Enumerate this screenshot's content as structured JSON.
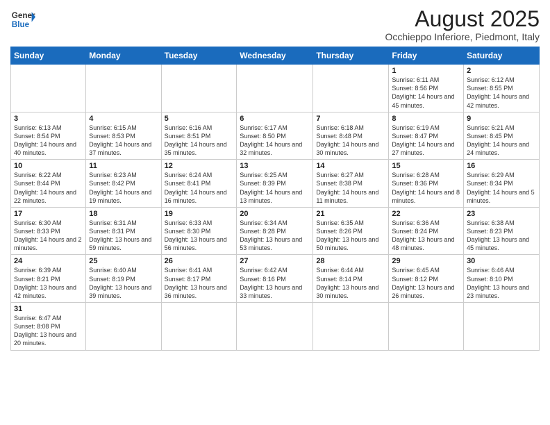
{
  "header": {
    "logo_general": "General",
    "logo_blue": "Blue",
    "title": "August 2025",
    "subtitle": "Occhieppo Inferiore, Piedmont, Italy"
  },
  "weekdays": [
    "Sunday",
    "Monday",
    "Tuesday",
    "Wednesday",
    "Thursday",
    "Friday",
    "Saturday"
  ],
  "weeks": [
    [
      {
        "day": "",
        "info": ""
      },
      {
        "day": "",
        "info": ""
      },
      {
        "day": "",
        "info": ""
      },
      {
        "day": "",
        "info": ""
      },
      {
        "day": "",
        "info": ""
      },
      {
        "day": "1",
        "info": "Sunrise: 6:11 AM\nSunset: 8:56 PM\nDaylight: 14 hours and 45 minutes."
      },
      {
        "day": "2",
        "info": "Sunrise: 6:12 AM\nSunset: 8:55 PM\nDaylight: 14 hours and 42 minutes."
      }
    ],
    [
      {
        "day": "3",
        "info": "Sunrise: 6:13 AM\nSunset: 8:54 PM\nDaylight: 14 hours and 40 minutes."
      },
      {
        "day": "4",
        "info": "Sunrise: 6:15 AM\nSunset: 8:53 PM\nDaylight: 14 hours and 37 minutes."
      },
      {
        "day": "5",
        "info": "Sunrise: 6:16 AM\nSunset: 8:51 PM\nDaylight: 14 hours and 35 minutes."
      },
      {
        "day": "6",
        "info": "Sunrise: 6:17 AM\nSunset: 8:50 PM\nDaylight: 14 hours and 32 minutes."
      },
      {
        "day": "7",
        "info": "Sunrise: 6:18 AM\nSunset: 8:48 PM\nDaylight: 14 hours and 30 minutes."
      },
      {
        "day": "8",
        "info": "Sunrise: 6:19 AM\nSunset: 8:47 PM\nDaylight: 14 hours and 27 minutes."
      },
      {
        "day": "9",
        "info": "Sunrise: 6:21 AM\nSunset: 8:45 PM\nDaylight: 14 hours and 24 minutes."
      }
    ],
    [
      {
        "day": "10",
        "info": "Sunrise: 6:22 AM\nSunset: 8:44 PM\nDaylight: 14 hours and 22 minutes."
      },
      {
        "day": "11",
        "info": "Sunrise: 6:23 AM\nSunset: 8:42 PM\nDaylight: 14 hours and 19 minutes."
      },
      {
        "day": "12",
        "info": "Sunrise: 6:24 AM\nSunset: 8:41 PM\nDaylight: 14 hours and 16 minutes."
      },
      {
        "day": "13",
        "info": "Sunrise: 6:25 AM\nSunset: 8:39 PM\nDaylight: 14 hours and 13 minutes."
      },
      {
        "day": "14",
        "info": "Sunrise: 6:27 AM\nSunset: 8:38 PM\nDaylight: 14 hours and 11 minutes."
      },
      {
        "day": "15",
        "info": "Sunrise: 6:28 AM\nSunset: 8:36 PM\nDaylight: 14 hours and 8 minutes."
      },
      {
        "day": "16",
        "info": "Sunrise: 6:29 AM\nSunset: 8:34 PM\nDaylight: 14 hours and 5 minutes."
      }
    ],
    [
      {
        "day": "17",
        "info": "Sunrise: 6:30 AM\nSunset: 8:33 PM\nDaylight: 14 hours and 2 minutes."
      },
      {
        "day": "18",
        "info": "Sunrise: 6:31 AM\nSunset: 8:31 PM\nDaylight: 13 hours and 59 minutes."
      },
      {
        "day": "19",
        "info": "Sunrise: 6:33 AM\nSunset: 8:30 PM\nDaylight: 13 hours and 56 minutes."
      },
      {
        "day": "20",
        "info": "Sunrise: 6:34 AM\nSunset: 8:28 PM\nDaylight: 13 hours and 53 minutes."
      },
      {
        "day": "21",
        "info": "Sunrise: 6:35 AM\nSunset: 8:26 PM\nDaylight: 13 hours and 50 minutes."
      },
      {
        "day": "22",
        "info": "Sunrise: 6:36 AM\nSunset: 8:24 PM\nDaylight: 13 hours and 48 minutes."
      },
      {
        "day": "23",
        "info": "Sunrise: 6:38 AM\nSunset: 8:23 PM\nDaylight: 13 hours and 45 minutes."
      }
    ],
    [
      {
        "day": "24",
        "info": "Sunrise: 6:39 AM\nSunset: 8:21 PM\nDaylight: 13 hours and 42 minutes."
      },
      {
        "day": "25",
        "info": "Sunrise: 6:40 AM\nSunset: 8:19 PM\nDaylight: 13 hours and 39 minutes."
      },
      {
        "day": "26",
        "info": "Sunrise: 6:41 AM\nSunset: 8:17 PM\nDaylight: 13 hours and 36 minutes."
      },
      {
        "day": "27",
        "info": "Sunrise: 6:42 AM\nSunset: 8:16 PM\nDaylight: 13 hours and 33 minutes."
      },
      {
        "day": "28",
        "info": "Sunrise: 6:44 AM\nSunset: 8:14 PM\nDaylight: 13 hours and 30 minutes."
      },
      {
        "day": "29",
        "info": "Sunrise: 6:45 AM\nSunset: 8:12 PM\nDaylight: 13 hours and 26 minutes."
      },
      {
        "day": "30",
        "info": "Sunrise: 6:46 AM\nSunset: 8:10 PM\nDaylight: 13 hours and 23 minutes."
      }
    ],
    [
      {
        "day": "31",
        "info": "Sunrise: 6:47 AM\nSunset: 8:08 PM\nDaylight: 13 hours and 20 minutes."
      },
      {
        "day": "",
        "info": ""
      },
      {
        "day": "",
        "info": ""
      },
      {
        "day": "",
        "info": ""
      },
      {
        "day": "",
        "info": ""
      },
      {
        "day": "",
        "info": ""
      },
      {
        "day": "",
        "info": ""
      }
    ]
  ]
}
